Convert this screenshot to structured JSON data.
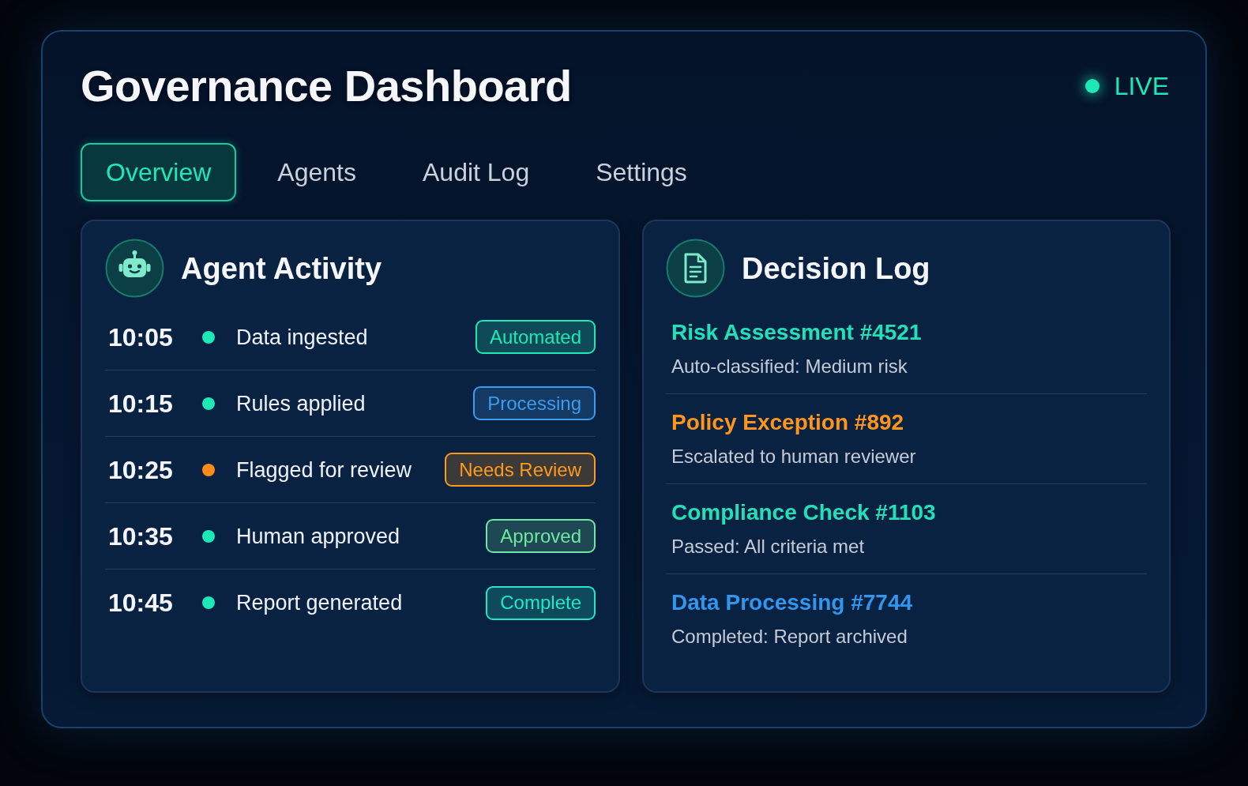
{
  "header": {
    "title": "Governance Dashboard",
    "live_indicator": {
      "label": "LIVE"
    }
  },
  "tabs": [
    {
      "label": "Overview",
      "selected": true
    },
    {
      "label": "Agents",
      "selected": false
    },
    {
      "label": "Audit Log",
      "selected": false
    },
    {
      "label": "Settings",
      "selected": false
    }
  ],
  "agent_activity": {
    "title": "Agent Activity",
    "rows": [
      {
        "time": "10:05",
        "color": "#1de9b6",
        "event": "Data ingested",
        "badge": {
          "label": "Automated",
          "color": "#1de9b6"
        }
      },
      {
        "time": "10:15",
        "color": "#1de9b6",
        "event": "Rules applied",
        "badge": {
          "label": "Processing",
          "color": "#3a9bf0"
        }
      },
      {
        "time": "10:25",
        "color": "#ff8c1a",
        "event": "Flagged for review",
        "badge": {
          "label": "Needs Review",
          "color": "#ff9a1a"
        }
      },
      {
        "time": "10:35",
        "color": "#1de9b6",
        "event": "Human approved",
        "badge": {
          "label": "Approved",
          "color": "#6ee7a0"
        }
      },
      {
        "time": "10:45",
        "color": "#1de9b6",
        "event": "Report generated",
        "badge": {
          "label": "Complete",
          "color": "#1de9c6"
        }
      }
    ]
  },
  "decision_log": {
    "title": "Decision Log",
    "entries": [
      {
        "title": "Risk Assessment #4521",
        "color": "#22e0b8",
        "detail": "Auto-classified: Medium risk"
      },
      {
        "title": "Policy Exception #892",
        "color": "#ff951c",
        "detail": "Escalated to human reviewer"
      },
      {
        "title": "Compliance Check #1103",
        "color": "#22e0b8",
        "detail": "Passed: All criteria met"
      },
      {
        "title": "Data Processing #7744",
        "color": "#3196ee",
        "detail": "Completed: Report archived"
      }
    ]
  }
}
